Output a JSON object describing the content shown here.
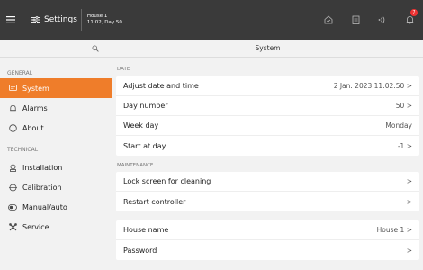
{
  "topbar": {
    "title": "Settings",
    "house_name": "House 1",
    "house_time": "11:02, Day 50",
    "alarm_count": "7"
  },
  "sidebar": {
    "section_general": "GENERAL",
    "section_technical": "TECHNICAL",
    "items_general": [
      {
        "label": "System"
      },
      {
        "label": "Alarms"
      },
      {
        "label": "About"
      }
    ],
    "items_technical": [
      {
        "label": "Installation"
      },
      {
        "label": "Calibration"
      },
      {
        "label": "Manual/auto"
      },
      {
        "label": "Service"
      }
    ]
  },
  "main": {
    "title": "System",
    "date_section": "DATE",
    "date_rows": [
      {
        "label": "Adjust date and time",
        "value": "2 Jan. 2023 11:02:50 >"
      },
      {
        "label": "Day number",
        "value": "50 >"
      },
      {
        "label": "Week day",
        "value": "Monday"
      },
      {
        "label": "Start at day",
        "value": "-1 >"
      }
    ],
    "maintenance_section": "MAINTENANCE",
    "maintenance_rows": [
      {
        "label": "Lock screen for cleaning",
        "value": ">"
      },
      {
        "label": "Restart controller",
        "value": ">"
      }
    ],
    "house_rows": [
      {
        "label": "House name",
        "value": "House 1 >"
      },
      {
        "label": "Password",
        "value": ">"
      }
    ]
  },
  "colors": {
    "accent": "#ef7d2a",
    "topbar": "#3a3a3a",
    "alarm_badge": "#ee3333"
  }
}
